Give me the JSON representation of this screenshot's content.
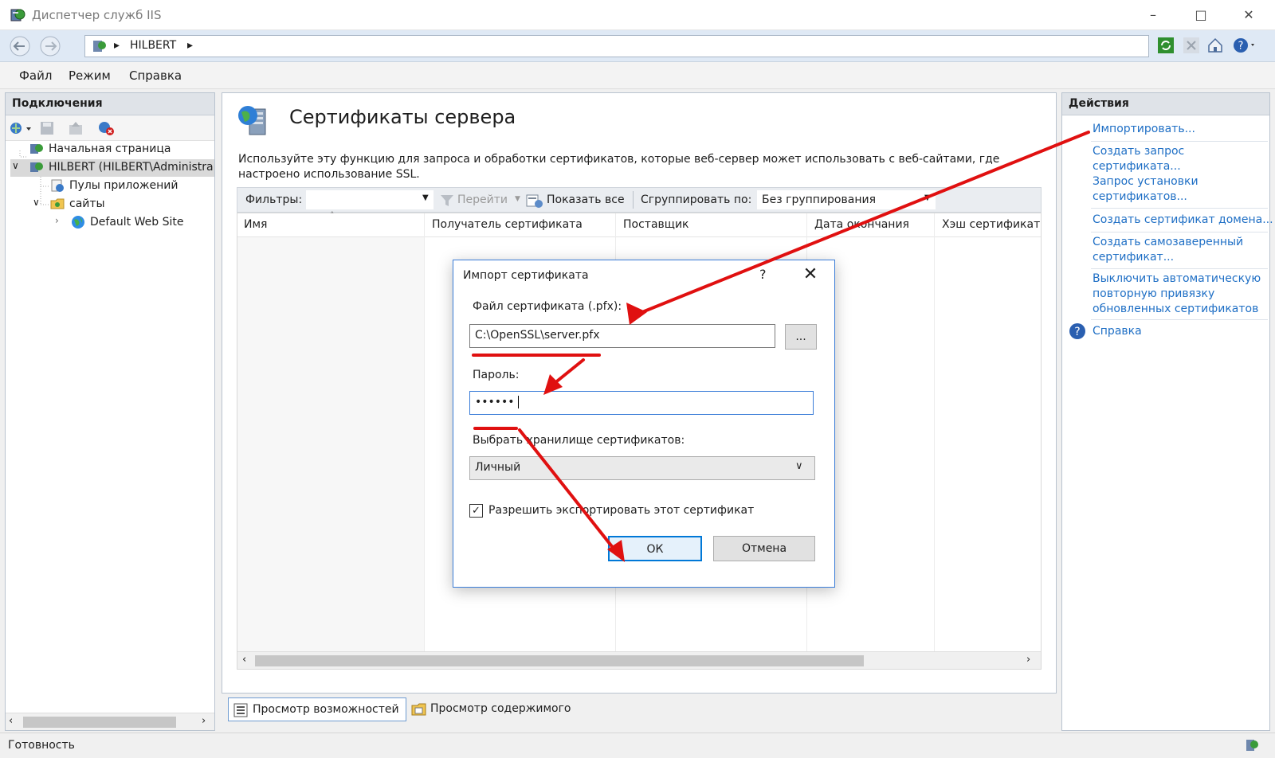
{
  "window": {
    "title": "Диспетчер служб IIS"
  },
  "address": {
    "segments": [
      "HILBERT"
    ]
  },
  "menu": {
    "items": [
      "Файл",
      "Режим",
      "Справка"
    ]
  },
  "connections": {
    "title": "Подключения",
    "tree": [
      {
        "label": "Начальная страница"
      },
      {
        "label": "HILBERT (HILBERT\\Administra"
      },
      {
        "label": "Пулы приложений"
      },
      {
        "label": "сайты"
      },
      {
        "label": "Default Web Site"
      }
    ]
  },
  "center": {
    "title": "Сертификаты сервера",
    "description": "Используйте эту функцию для запроса и обработки сертификатов, которые веб-сервер может использовать с веб-сайтами, где настроено использование SSL.",
    "filter_label": "Фильтры:",
    "go_label": "Перейти",
    "show_all_label": "Показать все",
    "group_by_label": "Сгруппировать по:",
    "group_by_value": "Без группирования",
    "columns": [
      "Имя",
      "Получатель сертификата",
      "Поставщик",
      "Дата окончания",
      "Хэш сертификат"
    ]
  },
  "tabs": {
    "features": "Просмотр возможностей",
    "content": "Просмотр содержимого"
  },
  "actions": {
    "title": "Действия",
    "import": "Импортировать...",
    "create_request_1": "Создать запрос",
    "create_request_2": "сертификата...",
    "complete_request_1": "Запрос установки",
    "complete_request_2": "сертификатов...",
    "domain_cert": "Создать сертификат домена...",
    "self_signed_1": "Создать самозаверенный",
    "self_signed_2": "сертификат...",
    "disable_rebind_1": "Выключить автоматическую",
    "disable_rebind_2": "повторную привязку",
    "disable_rebind_3": "обновленных сертификатов",
    "help": "Справка"
  },
  "status": {
    "text": "Готовность"
  },
  "dialog": {
    "title": "Импорт сертификата",
    "help": "?",
    "file_label": "Файл сертификата (.pfx):",
    "file_value": "C:\\OpenSSL\\server.pfx",
    "browse_label": "...",
    "password_label": "Пароль:",
    "password_value": "•••••• ",
    "store_label": "Выбрать хранилище сертификатов:",
    "store_value": "Личный",
    "export_label": "Разрешить экспортировать этот сертификат",
    "export_checked": true,
    "ok_label": "ОК",
    "cancel_label": "Отмена"
  },
  "colors": {
    "link": "#1f6fc5",
    "annotation": "#e01010",
    "focus": "#3b7dd8"
  }
}
